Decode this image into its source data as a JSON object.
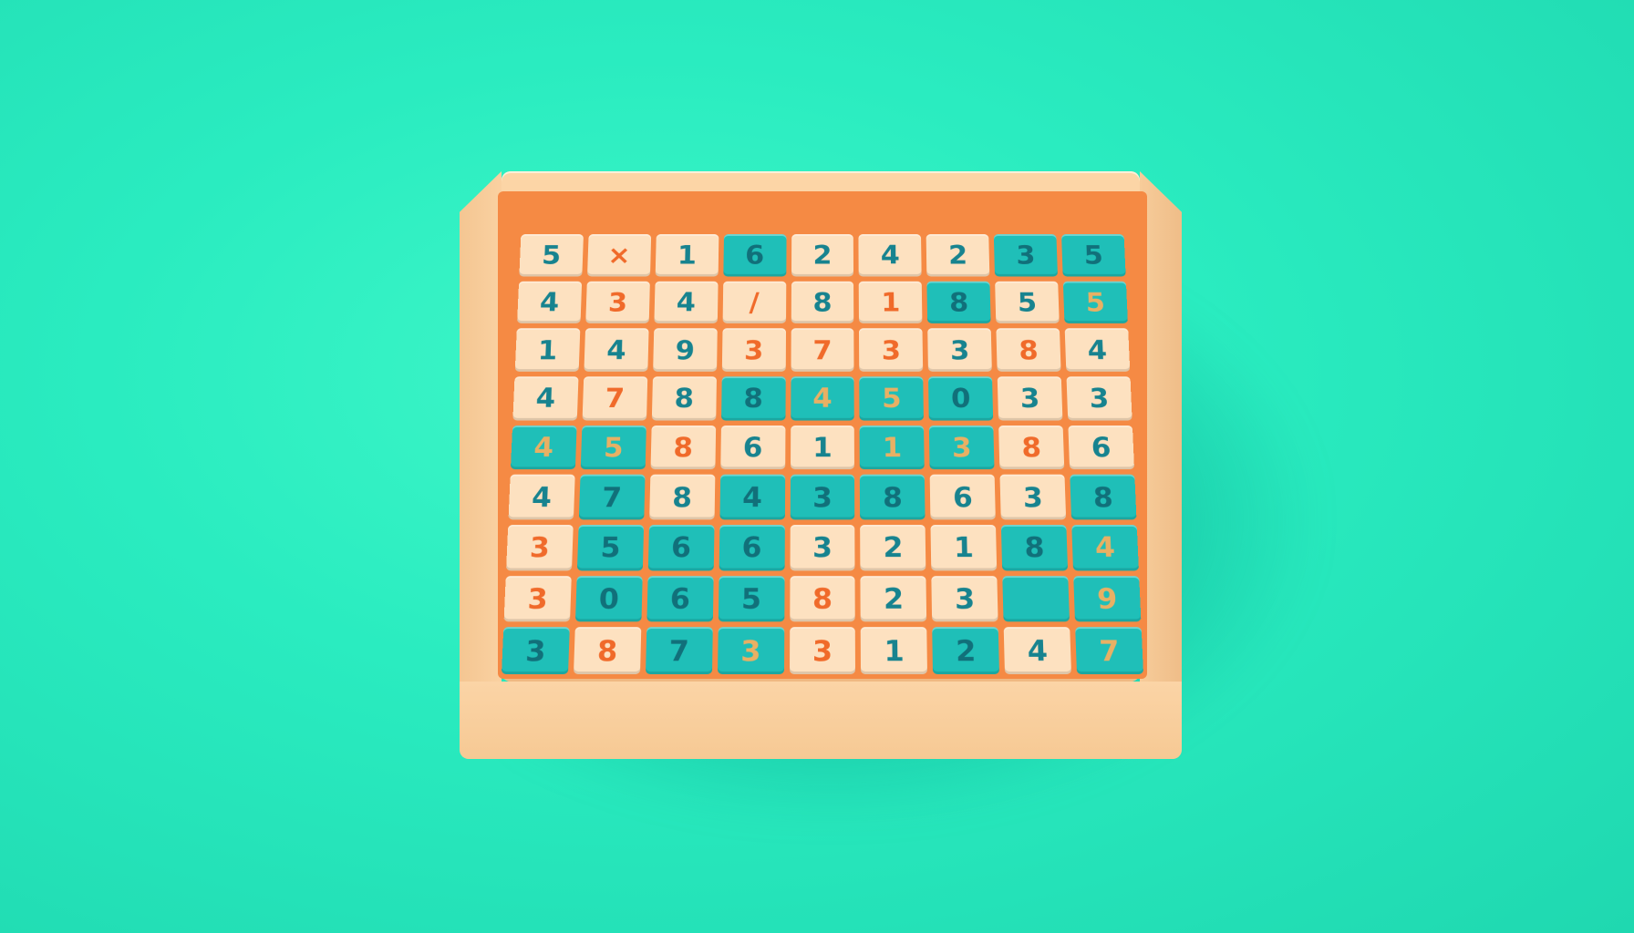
{
  "colors": {
    "background": "#2aecc0",
    "board": "#fcd5a6",
    "well": "#f58a44",
    "tile_peach": "#fde1c0",
    "tile_teal": "#1fbfb8",
    "digit_teal": "#17838f",
    "digit_orange": "#f06a2a",
    "digit_gold": "#e8b064"
  },
  "grid": [
    [
      {
        "v": "5",
        "t": "peach",
        "c": "teal"
      },
      {
        "v": "×",
        "t": "peach",
        "c": "orange"
      },
      {
        "v": "1",
        "t": "peach",
        "c": "teal"
      },
      {
        "v": "6",
        "t": "teal",
        "c": "dark"
      },
      {
        "v": "2",
        "t": "peach",
        "c": "teal"
      },
      {
        "v": "4",
        "t": "peach",
        "c": "teal"
      },
      {
        "v": "2",
        "t": "peach",
        "c": "teal"
      },
      {
        "v": "3",
        "t": "teal",
        "c": "dark"
      },
      {
        "v": "5",
        "t": "teal",
        "c": "dark"
      }
    ],
    [
      {
        "v": "4",
        "t": "peach",
        "c": "teal"
      },
      {
        "v": "3",
        "t": "peach",
        "c": "orange"
      },
      {
        "v": "4",
        "t": "peach",
        "c": "teal"
      },
      {
        "v": "/",
        "t": "peach",
        "c": "orange"
      },
      {
        "v": "8",
        "t": "peach",
        "c": "teal"
      },
      {
        "v": "1",
        "t": "peach",
        "c": "orange"
      },
      {
        "v": "8",
        "t": "teal",
        "c": "dark"
      },
      {
        "v": "5",
        "t": "peach",
        "c": "teal"
      },
      {
        "v": "5",
        "t": "teal",
        "c": "gold"
      }
    ],
    [
      {
        "v": "1",
        "t": "peach",
        "c": "teal"
      },
      {
        "v": "4",
        "t": "peach",
        "c": "teal"
      },
      {
        "v": "9",
        "t": "peach",
        "c": "teal"
      },
      {
        "v": "3",
        "t": "peach",
        "c": "orange"
      },
      {
        "v": "7",
        "t": "peach",
        "c": "orange"
      },
      {
        "v": "3",
        "t": "peach",
        "c": "orange"
      },
      {
        "v": "3",
        "t": "peach",
        "c": "teal"
      },
      {
        "v": "8",
        "t": "peach",
        "c": "orange"
      },
      {
        "v": "4",
        "t": "peach",
        "c": "teal"
      }
    ],
    [
      {
        "v": "4",
        "t": "peach",
        "c": "teal"
      },
      {
        "v": "7",
        "t": "peach",
        "c": "orange"
      },
      {
        "v": "8",
        "t": "peach",
        "c": "teal"
      },
      {
        "v": "8",
        "t": "teal",
        "c": "dark"
      },
      {
        "v": "4",
        "t": "teal",
        "c": "gold"
      },
      {
        "v": "5",
        "t": "teal",
        "c": "gold"
      },
      {
        "v": "0",
        "t": "teal",
        "c": "dark"
      },
      {
        "v": "3",
        "t": "peach",
        "c": "teal"
      },
      {
        "v": "3",
        "t": "peach",
        "c": "teal"
      }
    ],
    [
      {
        "v": "4",
        "t": "teal",
        "c": "gold"
      },
      {
        "v": "5",
        "t": "teal",
        "c": "gold"
      },
      {
        "v": "8",
        "t": "peach",
        "c": "orange"
      },
      {
        "v": "6",
        "t": "peach",
        "c": "teal"
      },
      {
        "v": "1",
        "t": "peach",
        "c": "teal"
      },
      {
        "v": "1",
        "t": "teal",
        "c": "gold"
      },
      {
        "v": "3",
        "t": "teal",
        "c": "gold"
      },
      {
        "v": "8",
        "t": "peach",
        "c": "orange"
      },
      {
        "v": "6",
        "t": "peach",
        "c": "teal"
      }
    ],
    [
      {
        "v": "4",
        "t": "peach",
        "c": "teal"
      },
      {
        "v": "7",
        "t": "teal",
        "c": "dark"
      },
      {
        "v": "8",
        "t": "peach",
        "c": "teal"
      },
      {
        "v": "4",
        "t": "teal",
        "c": "dark"
      },
      {
        "v": "3",
        "t": "teal",
        "c": "dark"
      },
      {
        "v": "8",
        "t": "teal",
        "c": "dark"
      },
      {
        "v": "6",
        "t": "peach",
        "c": "teal"
      },
      {
        "v": "3",
        "t": "peach",
        "c": "teal"
      },
      {
        "v": "8",
        "t": "teal",
        "c": "dark"
      }
    ],
    [
      {
        "v": "3",
        "t": "peach",
        "c": "orange"
      },
      {
        "v": "5",
        "t": "teal",
        "c": "dark"
      },
      {
        "v": "6",
        "t": "teal",
        "c": "dark"
      },
      {
        "v": "6",
        "t": "teal",
        "c": "dark"
      },
      {
        "v": "3",
        "t": "peach",
        "c": "teal"
      },
      {
        "v": "2",
        "t": "peach",
        "c": "teal"
      },
      {
        "v": "1",
        "t": "peach",
        "c": "teal"
      },
      {
        "v": "8",
        "t": "teal",
        "c": "dark"
      },
      {
        "v": "4",
        "t": "teal",
        "c": "gold"
      }
    ],
    [
      {
        "v": "3",
        "t": "peach",
        "c": "orange"
      },
      {
        "v": "0",
        "t": "teal",
        "c": "dark"
      },
      {
        "v": "6",
        "t": "teal",
        "c": "dark"
      },
      {
        "v": "5",
        "t": "teal",
        "c": "dark"
      },
      {
        "v": "8",
        "t": "peach",
        "c": "orange"
      },
      {
        "v": "2",
        "t": "peach",
        "c": "teal"
      },
      {
        "v": "3",
        "t": "peach",
        "c": "teal"
      },
      {
        "v": "",
        "t": "teal",
        "c": "dark"
      },
      {
        "v": "9",
        "t": "teal",
        "c": "gold"
      }
    ],
    [
      {
        "v": "3",
        "t": "teal",
        "c": "dark"
      },
      {
        "v": "8",
        "t": "peach",
        "c": "orange"
      },
      {
        "v": "7",
        "t": "teal",
        "c": "dark"
      },
      {
        "v": "3",
        "t": "teal",
        "c": "gold"
      },
      {
        "v": "3",
        "t": "peach",
        "c": "orange"
      },
      {
        "v": "1",
        "t": "peach",
        "c": "teal"
      },
      {
        "v": "2",
        "t": "teal",
        "c": "dark"
      },
      {
        "v": "4",
        "t": "peach",
        "c": "teal"
      },
      {
        "v": "7",
        "t": "teal",
        "c": "gold"
      }
    ]
  ]
}
